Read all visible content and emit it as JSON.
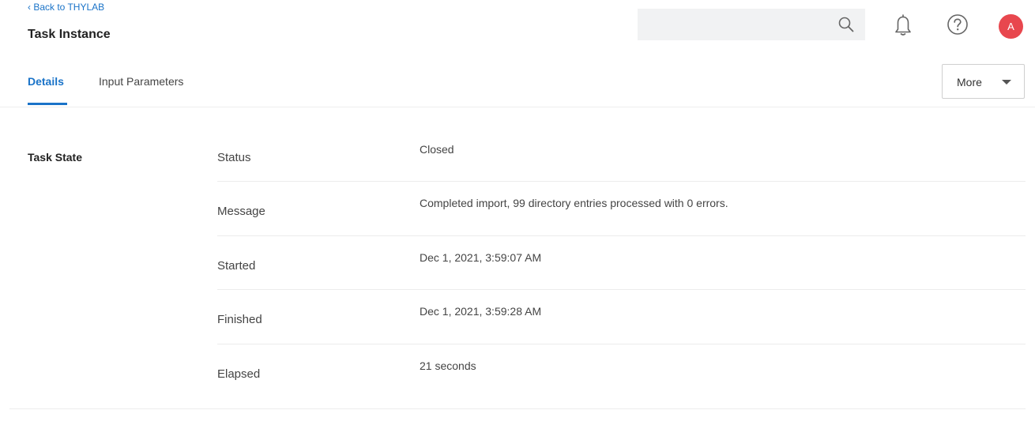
{
  "header": {
    "back_link": "‹ Back to THYLAB",
    "title": "Task Instance",
    "search": {
      "value": "",
      "placeholder": ""
    },
    "avatar_initial": "A"
  },
  "tabs": [
    {
      "label": "Details",
      "active": true
    },
    {
      "label": "Input Parameters",
      "active": false
    }
  ],
  "more_button": {
    "label": "More"
  },
  "task_state": {
    "section_title": "Task State",
    "rows": [
      {
        "label": "Status",
        "value": "Closed"
      },
      {
        "label": "Message",
        "value": "Completed import, 99 directory entries processed with 0 errors."
      },
      {
        "label": "Started",
        "value": "Dec 1, 2021, 3:59:07 AM"
      },
      {
        "label": "Finished",
        "value": "Dec 1, 2021, 3:59:28 AM"
      },
      {
        "label": "Elapsed",
        "value": "21 seconds"
      }
    ]
  },
  "icons": {
    "search": "search-icon",
    "notifications": "bell-icon",
    "help": "help-icon",
    "dropdown": "caret-down-icon"
  },
  "colors": {
    "accent": "#1a73c8",
    "avatar": "#e8474e",
    "search_bg": "#f1f2f3"
  }
}
